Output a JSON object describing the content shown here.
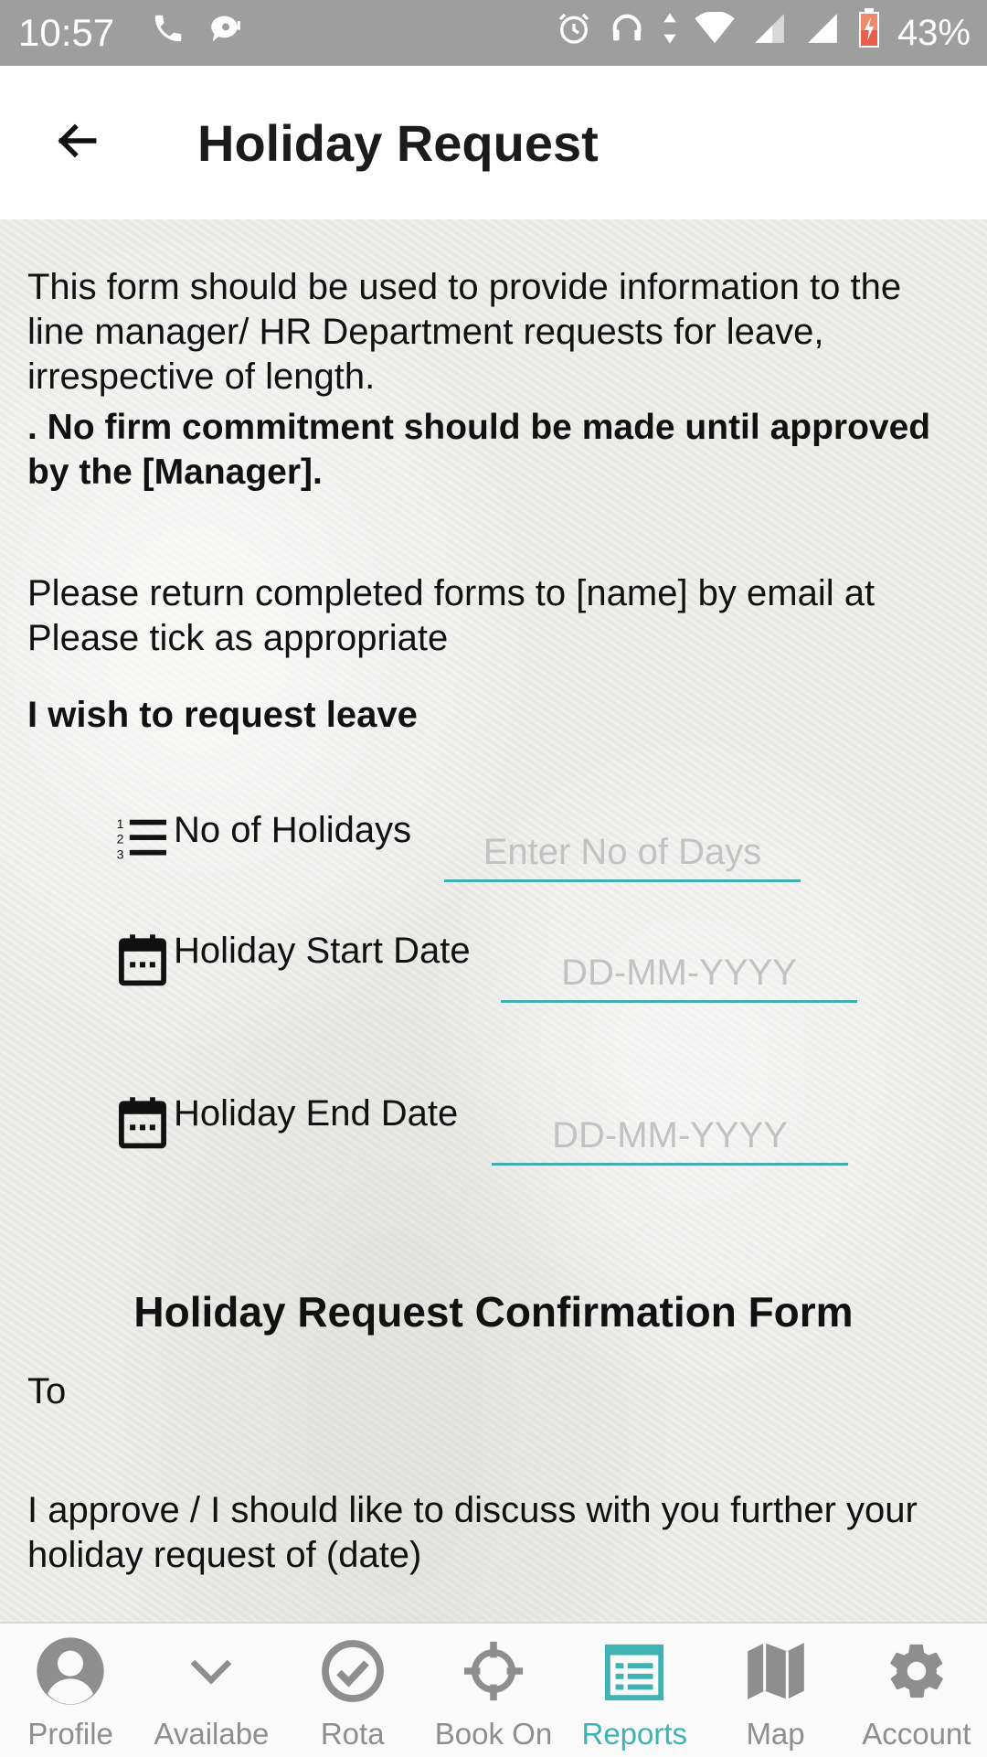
{
  "status_bar": {
    "time": "10:57",
    "battery": "43%",
    "icons": [
      "phone-icon",
      "chat-icon",
      "alarm-icon",
      "headset-icon",
      "data-arrows-icon",
      "wifi-icon",
      "signal-icon",
      "signal-icon",
      "battery-icon"
    ]
  },
  "app_bar": {
    "title": "Holiday Request",
    "back_icon": "arrow-back-icon"
  },
  "intro": {
    "text": "This form should be used to provide information to the line manager/ HR Department requests for leave, irrespective of length.",
    "note": ". No firm commitment should be made until approved by the [Manager]."
  },
  "return_text": "Please return completed forms to [name] by email at Please tick as appropriate",
  "request_heading": "I wish to request leave",
  "fields": {
    "holidays": {
      "label": "No of Holidays",
      "placeholder": "Enter No of Days",
      "icon": "numbered-list-icon"
    },
    "start_date": {
      "label": "Holiday Start Date",
      "placeholder": "DD-MM-YYYY",
      "icon": "calendar-icon"
    },
    "end_date": {
      "label": "Holiday End Date",
      "placeholder": "DD-MM-YYYY",
      "icon": "calendar-icon"
    }
  },
  "confirmation": {
    "title": "Holiday Request Confirmation Form",
    "to_label": "To",
    "approve_text": "I approve / I should like to discuss with you further your holiday request of (date)"
  },
  "bottom_nav": {
    "items": [
      {
        "label": "Profile",
        "icon": "profile-icon",
        "active": false
      },
      {
        "label": "Availabe",
        "icon": "chevron-down-icon",
        "active": false
      },
      {
        "label": "Rota",
        "icon": "check-circle-icon",
        "active": false
      },
      {
        "label": "Book On",
        "icon": "crosshair-icon",
        "active": false
      },
      {
        "label": "Reports",
        "icon": "reports-icon",
        "active": true
      },
      {
        "label": "Map",
        "icon": "map-icon",
        "active": false
      },
      {
        "label": "Account",
        "icon": "gear-icon",
        "active": false
      }
    ]
  },
  "colors": {
    "accent": "#3fb2b4",
    "status_bar": "#9e9e9e",
    "nav_inactive": "#8e8e8e"
  }
}
